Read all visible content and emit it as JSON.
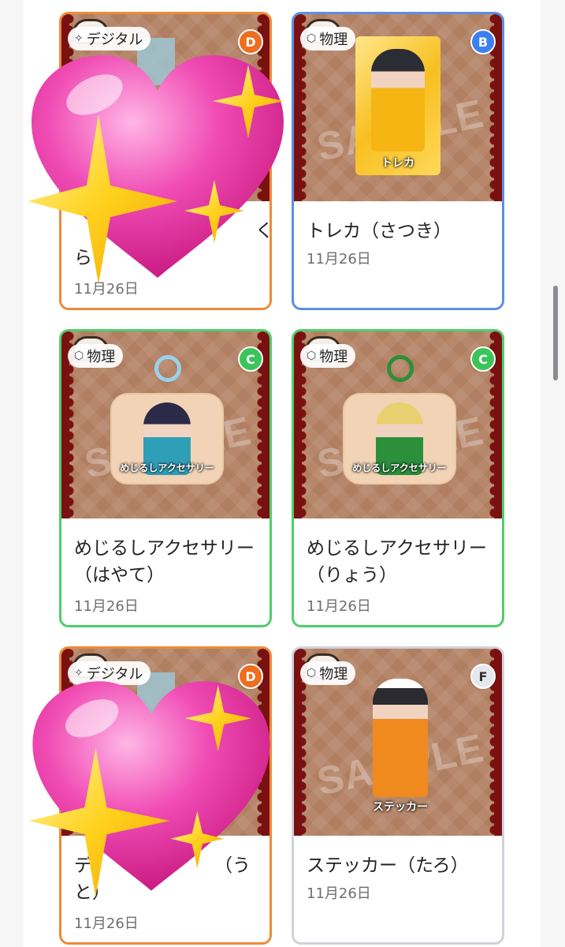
{
  "colors": {
    "digital": "#f08a36",
    "physical_b": "#5b8fe5",
    "physical_c": "#4fce6c",
    "physical_f": "#cfd2da",
    "rank_D": "#ef6d1f",
    "rank_B": "#3c7ff0",
    "rank_C": "#3bc45a",
    "rank_F": "#e6e7ec",
    "card_bg": "#b07e60"
  },
  "cards": [
    {
      "type_label": "デジタル",
      "type_icon": "sparkle-icon",
      "rank": "D",
      "name": "",
      "date": "11月26日",
      "cover": "heart"
    },
    {
      "type_label": "物理",
      "type_icon": "box-icon",
      "rank": "B",
      "name": "トレカ（さつき）",
      "date": "11月26日",
      "watermark": "SAMPLE",
      "item_label": "トレカ"
    },
    {
      "type_label": "物理",
      "type_icon": "box-icon",
      "rank": "C",
      "name": "めじるしアクセサリー（はやて）",
      "date": "11月26日",
      "watermark": "SAMPLE",
      "item_label": "めじるしアクセサリー"
    },
    {
      "type_label": "物理",
      "type_icon": "box-icon",
      "rank": "C",
      "name": "めじるしアクセサリー（りょう）",
      "date": "11月26日",
      "watermark": "SAMPLE",
      "item_label": "めじるしアクセサリー"
    },
    {
      "type_label": "デジタル",
      "type_icon": "sparkle-icon",
      "rank": "D",
      "name": "",
      "date": "11月26日",
      "cover": "heart"
    },
    {
      "type_label": "物理",
      "type_icon": "box-icon",
      "rank": "F",
      "name": "ステッカー（たろ）",
      "date": "11月26日",
      "watermark": "SAMPLE",
      "item_label": "ステッカー"
    }
  ],
  "partial_text": {
    "card1_line1_end": "く",
    "card1_line2": "ら",
    "card5_line1_start": "デ",
    "card5_line1_end": "（う",
    "card5_line2": "と）"
  }
}
